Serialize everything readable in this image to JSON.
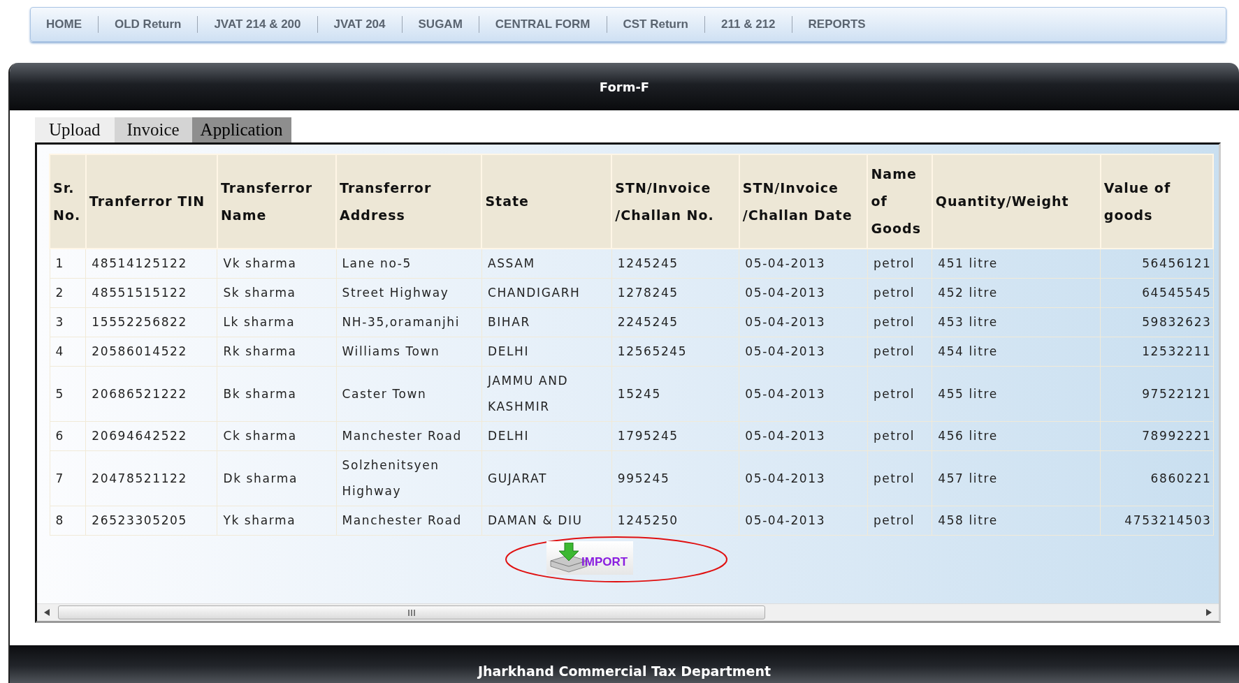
{
  "nav": [
    {
      "label": "HOME"
    },
    {
      "label": "OLD Return"
    },
    {
      "label": "JVAT 214 & 200"
    },
    {
      "label": "JVAT 204"
    },
    {
      "label": "SUGAM"
    },
    {
      "label": "CENTRAL FORM"
    },
    {
      "label": "CST Return"
    },
    {
      "label": "211 & 212"
    },
    {
      "label": "REPORTS"
    }
  ],
  "panel": {
    "title": "Form-F"
  },
  "tabs": [
    {
      "label": "Upload",
      "selected": false
    },
    {
      "label": "Invoice",
      "selected": false
    },
    {
      "label": "Application",
      "selected": true
    }
  ],
  "table": {
    "columns": [
      "Sr. No.",
      "Tranferror TIN",
      "Transferror Name",
      "Transferror Address",
      "State",
      "STN/Invoice /Challan No.",
      "STN/Invoice /Challan Date",
      "Name of Goods",
      "Quantity/Weight",
      "Value of goods"
    ],
    "rows": [
      [
        "1",
        "48514125122",
        "Vk sharma",
        "Lane no-5",
        "ASSAM",
        "1245245",
        "05-04-2013",
        "petrol",
        "451 litre",
        "56456121"
      ],
      [
        "2",
        "48551515122",
        "Sk sharma",
        "Street Highway",
        "CHANDIGARH",
        "1278245",
        "05-04-2013",
        "petrol",
        "452 litre",
        "64545545"
      ],
      [
        "3",
        "15552256822",
        "Lk sharma",
        "NH-35,oramanjhi",
        "BIHAR",
        "2245245",
        "05-04-2013",
        "petrol",
        "453 litre",
        "59832623"
      ],
      [
        "4",
        "20586014522",
        "Rk sharma",
        "Williams Town",
        "DELHI",
        "12565245",
        "05-04-2013",
        "petrol",
        "454 litre",
        "12532211"
      ],
      [
        "5",
        "20686521222",
        "Bk sharma",
        "Caster Town",
        "JAMMU AND KASHMIR",
        "15245",
        "05-04-2013",
        "petrol",
        "455 litre",
        "97522121"
      ],
      [
        "6",
        "20694642522",
        "Ck sharma",
        "Manchester Road",
        "DELHI",
        "1795245",
        "05-04-2013",
        "petrol",
        "456 litre",
        "78992221"
      ],
      [
        "7",
        "20478521122",
        "Dk sharma",
        "Solzhenitsyen Highway",
        "GUJARAT",
        "995245",
        "05-04-2013",
        "petrol",
        "457 litre",
        "6860221"
      ],
      [
        "8",
        "26523305205",
        "Yk sharma",
        "Manchester Road",
        "DAMAN & DIU",
        "1245250",
        "05-04-2013",
        "petrol",
        "458 litre",
        "4753214503"
      ]
    ]
  },
  "import_button": {
    "label": "IMPORT"
  },
  "footer": {
    "text": "Jharkhand Commercial Tax Department"
  }
}
